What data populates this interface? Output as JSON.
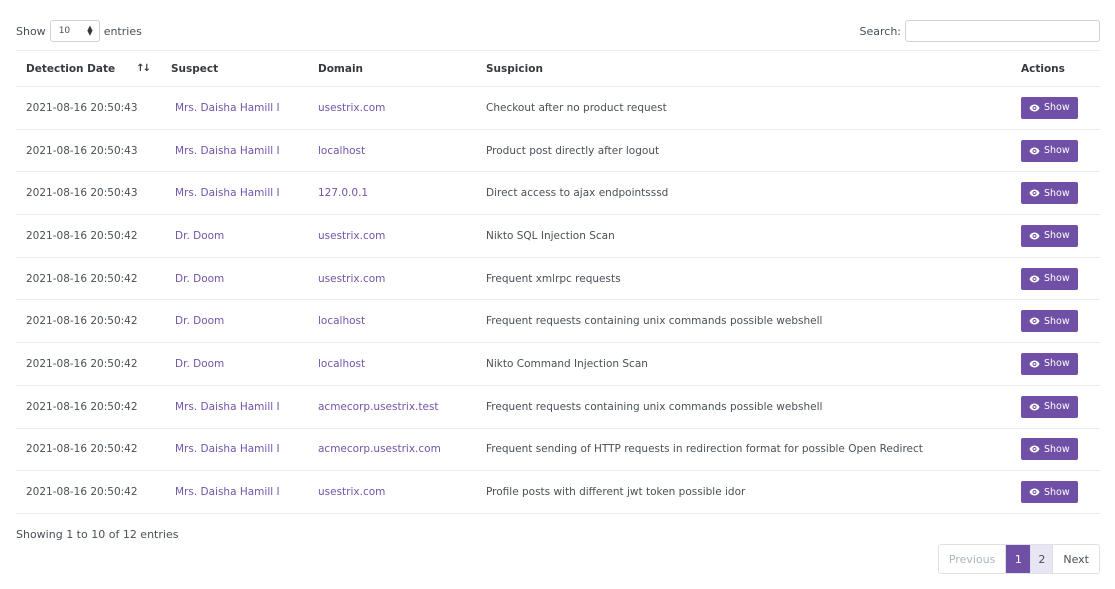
{
  "length_menu": {
    "prefix": "Show",
    "value": "10",
    "suffix": "entries"
  },
  "search": {
    "label": "Search:",
    "value": ""
  },
  "columns": [
    "Detection Date",
    "Suspect",
    "Domain",
    "Suspicion",
    "Actions"
  ],
  "rows": [
    {
      "date": "2021-08-16 20:50:43",
      "suspect": "Mrs. Daisha Hamill I",
      "domain": "usestrix.com",
      "suspicion": "Checkout after no product request",
      "action": "Show"
    },
    {
      "date": "2021-08-16 20:50:43",
      "suspect": "Mrs. Daisha Hamill I",
      "domain": "localhost",
      "suspicion": "Product post directly after logout",
      "action": "Show"
    },
    {
      "date": "2021-08-16 20:50:43",
      "suspect": "Mrs. Daisha Hamill I",
      "domain": "127.0.0.1",
      "suspicion": "Direct access to ajax endpointsssd",
      "action": "Show"
    },
    {
      "date": "2021-08-16 20:50:42",
      "suspect": "Dr. Doom",
      "domain": "usestrix.com",
      "suspicion": "Nikto SQL Injection Scan",
      "action": "Show"
    },
    {
      "date": "2021-08-16 20:50:42",
      "suspect": "Dr. Doom",
      "domain": "usestrix.com",
      "suspicion": "Frequent xmlrpc requests",
      "action": "Show"
    },
    {
      "date": "2021-08-16 20:50:42",
      "suspect": "Dr. Doom",
      "domain": "localhost",
      "suspicion": "Frequent requests containing unix commands possible webshell",
      "action": "Show"
    },
    {
      "date": "2021-08-16 20:50:42",
      "suspect": "Dr. Doom",
      "domain": "localhost",
      "suspicion": "Nikto Command Injection Scan",
      "action": "Show"
    },
    {
      "date": "2021-08-16 20:50:42",
      "suspect": "Mrs. Daisha Hamill I",
      "domain": "acmecorp.usestrix.test",
      "suspicion": "Frequent requests containing unix commands possible webshell",
      "action": "Show"
    },
    {
      "date": "2021-08-16 20:50:42",
      "suspect": "Mrs. Daisha Hamill I",
      "domain": "acmecorp.usestrix.com",
      "suspicion": "Frequent sending of HTTP requests in redirection format for possible Open Redirect",
      "action": "Show"
    },
    {
      "date": "2021-08-16 20:50:42",
      "suspect": "Mrs. Daisha Hamill I",
      "domain": "usestrix.com",
      "suspicion": "Profile posts with different jwt token possible idor",
      "action": "Show"
    }
  ],
  "icons": {
    "sort": "sort-icon",
    "action": "eye-icon"
  },
  "info": "Showing 1 to 10 of 12 entries",
  "pagination": {
    "previous": "Previous",
    "pages": [
      "1",
      "2"
    ],
    "current": "1",
    "next": "Next"
  },
  "colors": {
    "accent": "#6f50a6",
    "link": "#7155a8"
  }
}
